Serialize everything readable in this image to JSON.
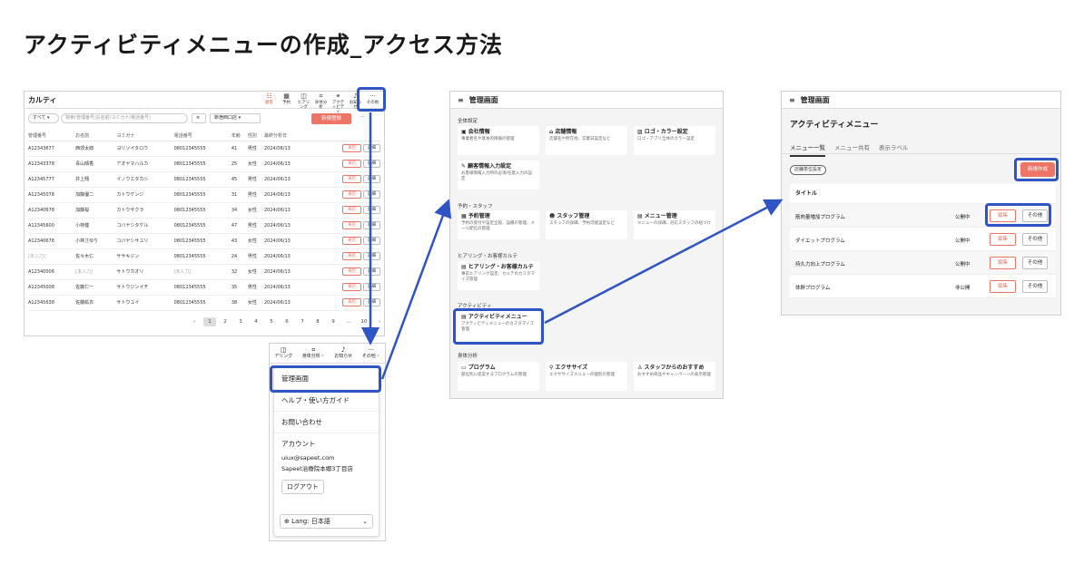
{
  "page_title": "アクティビティメニューの作成_アクセス方法",
  "p1": {
    "app_title": "カルティ",
    "nav": [
      {
        "icon": "users-icon",
        "glyph": "☷",
        "label": "顧客",
        "active": true
      },
      {
        "icon": "calendar-icon",
        "glyph": "▦",
        "label": "予約"
      },
      {
        "icon": "chat-icon",
        "glyph": "◫",
        "label": "ヒアリング"
      },
      {
        "icon": "scan-icon",
        "glyph": "⌗",
        "label": "身体分析"
      },
      {
        "icon": "activity-icon",
        "glyph": "⚭",
        "label": "アクティビティ"
      },
      {
        "icon": "bell-icon",
        "glyph": "♪",
        "label": "お知らせ"
      },
      {
        "icon": "more-icon",
        "glyph": "···",
        "label": "その他"
      }
    ],
    "filter_all": "すべて",
    "search_placeholder": "検索(管理番号/お名前/ヨミガナ/電話番号)",
    "store": "新宿西口店",
    "new_button": "新規登録",
    "columns": [
      "管理番号",
      "お名前",
      "ヨミガナ",
      "電話番号",
      "年齢",
      "性別",
      "最終分析日"
    ],
    "rows": [
      [
        "A12343677",
        "西郊太郎",
        "ヨリソイタロウ",
        "08012345555",
        "41",
        "男性",
        "2024/06/13"
      ],
      [
        "A12343378",
        "青山晴香",
        "アオヤマハルカ",
        "08012345555",
        "25",
        "女性",
        "2024/06/13"
      ],
      [
        "A12345777",
        "井上翔",
        "イノウエタカシ",
        "08012345555",
        "45",
        "男性",
        "2024/06/13"
      ],
      [
        "A12345078",
        "加藤優二",
        "カトウケンジ",
        "08012345555",
        "31",
        "男性",
        "2024/06/13"
      ],
      [
        "A12340678",
        "加藤桜",
        "カトウサクラ",
        "08012345555",
        "34",
        "女性",
        "2024/06/13"
      ],
      [
        "A12345600",
        "小林健",
        "コバヤシタケル",
        "08012345555",
        "47",
        "男性",
        "2024/06/13"
      ],
      [
        "A12340678",
        "小林さゆり",
        "コバヤシサユリ",
        "08012345555",
        "43",
        "女性",
        "2024/06/13"
      ],
      [
        "[未入力]",
        "佐々木仁",
        "ササキジン",
        "08012345555",
        "24",
        "男性",
        "2024/06/13"
      ],
      [
        "A12340006",
        "[未入力]",
        "サトウカオリ",
        "[未入力]",
        "32",
        "女性",
        "2024/06/13"
      ],
      [
        "A12345008",
        "佐藤仁一",
        "サトウジンイチ",
        "08012345555",
        "35",
        "男性",
        "2024/06/13"
      ],
      [
        "A12345638",
        "佐藤紘衣",
        "サトウユイ",
        "08012345555",
        "38",
        "女性",
        "2024/06/13"
      ]
    ],
    "row_btn_visit": "来店",
    "row_btn_detail": "詳細",
    "pager": [
      "1",
      "2",
      "3",
      "4",
      "5",
      "6",
      "7",
      "8",
      "9",
      "...",
      "10"
    ]
  },
  "p2": {
    "nav": [
      {
        "icon": "chat-icon",
        "glyph": "◫",
        "label": "アリング"
      },
      {
        "icon": "scan-icon",
        "glyph": "⌗",
        "label": "身体分析・"
      },
      {
        "icon": "bell-icon",
        "glyph": "♪",
        "label": "お知らせ"
      },
      {
        "icon": "more-icon",
        "glyph": "···",
        "label": "その他・"
      }
    ],
    "menu_admin": "管理画面",
    "menu_help": "ヘルプ・使い方ガイド",
    "menu_contact": "お問い合わせ",
    "account_label": "アカウント",
    "email": "uiux@sapeet.com",
    "store": "Sapeet治療院本郷3丁目店",
    "logout": "ログアウト",
    "lang": "Lang: 日本語"
  },
  "p3": {
    "header": "管理画面",
    "sections": {
      "all": "全体設定",
      "reserve": "予約・スタッフ",
      "hearing": "ヒアリング・お客様カルテ",
      "activity": "アクティビティ",
      "body": "身体分析"
    },
    "cards": {
      "company": {
        "t": "会社情報",
        "d": "事業者名や基本的情報の管理"
      },
      "store": {
        "t": "店舗情報",
        "d": "店舗名や所在地、営業日設定など"
      },
      "logo": {
        "t": "ロゴ・カラー設定",
        "d": "ロゴ・アプリ全体のカラー設定"
      },
      "customer": {
        "t": "顧客情報入力設定",
        "d": "お客様情報入力時の必須/任意入力の設定"
      },
      "reservation": {
        "t": "予約管理",
        "d": "予約の受付や設定全般、設備の管理、メール配信の管理"
      },
      "staff": {
        "t": "スタッフ管理",
        "d": "スタッフの詳細、予約可能設定など"
      },
      "menu": {
        "t": "メニュー管理",
        "d": "メニューの詳細、対応スタッフの紐づけ"
      },
      "hearing": {
        "t": "ヒアリング・お客様カルテ",
        "d": "事前ヒアリング設定、カルテのカスタマイズ管理"
      },
      "activity": {
        "t": "アクティビティメニュー",
        "d": "アクティビティメニューのカスタマイズ管理"
      },
      "program": {
        "t": "プログラム",
        "d": "部位別に提案するプログラムの管理"
      },
      "exercise": {
        "t": "エクササイズ",
        "d": "エクササイズメニューの個別の管理"
      },
      "recommend": {
        "t": "スタッフからのおすすめ",
        "d": "おすすめ商品やキャンペーンの表示管理"
      }
    }
  },
  "p4": {
    "header": "管理画面",
    "title": "アクティビティメニュー",
    "tabs": [
      "メニュー一覧",
      "メニュー共有",
      "表示ラベル"
    ],
    "filter": "店舗単位設定",
    "new_button": "新規作成",
    "list_header": "タイトル",
    "edit": "編集",
    "other": "その他",
    "rows": [
      {
        "name": "筋肉量増加プログラム",
        "status": "公開中"
      },
      {
        "name": "ダイエットプログラム",
        "status": "公開中"
      },
      {
        "name": "持久力向上プログラム",
        "status": "公開中"
      },
      {
        "name": "体幹プログラム",
        "status": "非公開"
      }
    ]
  },
  "colors": {
    "accent": "#ee7465",
    "highlight": "#2f55c4"
  }
}
